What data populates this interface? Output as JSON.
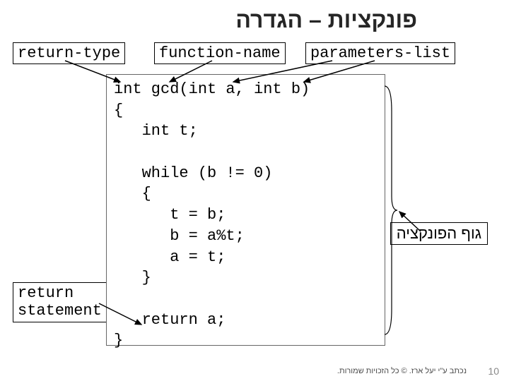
{
  "title": "פונקציות – הגדרה",
  "labels": {
    "return_type": "return-type",
    "function_name": "function-name",
    "parameters_list": "parameters-list",
    "return_statement_l1": "return",
    "return_statement_l2": "statement",
    "body_label": "גוף הפונקציה"
  },
  "code": "int gcd(int a, int b)\n{\n   int t;\n\n   while (b != 0)\n   {\n      t = b;\n      b = a%t;\n      a = t;\n   }\n\n   return a;\n}",
  "footer": "נכתב ע\"י יעל ארז. © כל הזכויות שמורות.",
  "page_number": "10"
}
